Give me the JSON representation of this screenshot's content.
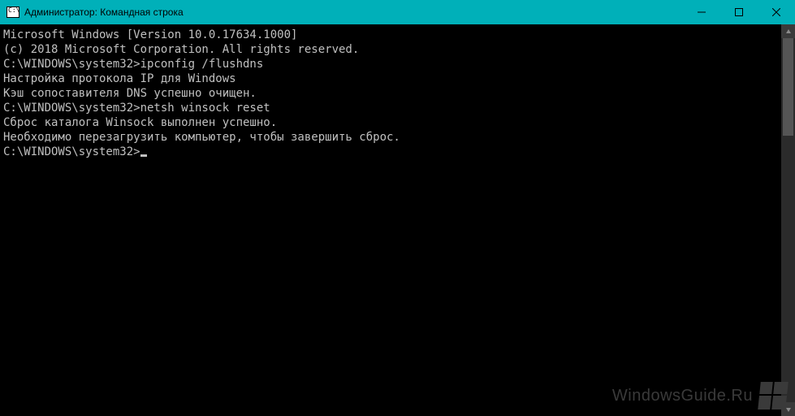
{
  "window": {
    "title": "Администратор: Командная строка"
  },
  "console": {
    "lines": [
      "Microsoft Windows [Version 10.0.17634.1000]",
      "(c) 2018 Microsoft Corporation. All rights reserved.",
      "",
      "C:\\WINDOWS\\system32>ipconfig /flushdns",
      "",
      "Настройка протокола IP для Windows",
      "",
      "Кэш сопоставителя DNS успешно очищен.",
      "",
      "C:\\WINDOWS\\system32>netsh winsock reset",
      "",
      "Сброс каталога Winsock выполнен успешно.",
      "Необходимо перезагрузить компьютер, чтобы завершить сброс.",
      "",
      "",
      "C:\\WINDOWS\\system32>"
    ],
    "prompt_cursor_line_index": 15
  },
  "watermark": {
    "text": "WindowsGuide.Ru"
  }
}
